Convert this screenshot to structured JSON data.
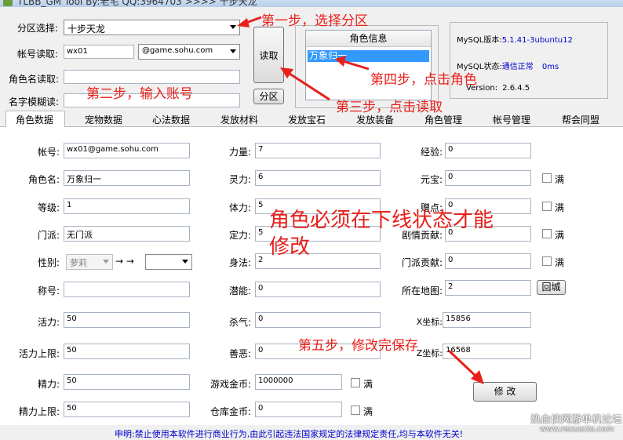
{
  "window": {
    "title": "TLBB_GM Tool By:老宅 QQ:3964703 >>>> 十步天龙"
  },
  "top": {
    "zone_label": "分区选择:",
    "zone_value": "十步天龙",
    "account_read_label": "帐号读取:",
    "account_value": "wx01",
    "domain_value": "@game.sohu.com",
    "role_read_label": "角色名读取:",
    "fuzzy_label": "名字模糊读:",
    "read_button": "读取",
    "zone_button": "分区",
    "role_group_title": "角色信息",
    "role_selected": "万象归一",
    "mysql_version_label": "MySQL版本:",
    "mysql_version_value": "5.1.41-3ubuntu12",
    "mysql_status_label": "MySQL状态:",
    "mysql_status_value": "通信正常",
    "mysql_latency": "0ms",
    "version_label": "Version:",
    "version_value": "2.6.4.5"
  },
  "tabs": [
    "角色数据",
    "宠物数据",
    "心法数据",
    "发放材料",
    "发放宝石",
    "发放装备",
    "角色管理",
    "帐号管理",
    "帮会同盟"
  ],
  "fields": {
    "account": {
      "label": "帐号:",
      "value": "wx01@game.sohu.com"
    },
    "role_name": {
      "label": "角色名:",
      "value": "万象归一"
    },
    "level": {
      "label": "等级:",
      "value": "1"
    },
    "sect": {
      "label": "门派:",
      "value": "无门派"
    },
    "gender": {
      "label": "性别:",
      "value": "萝莉",
      "arrows": "→ →"
    },
    "title": {
      "label": "称号:",
      "value": ""
    },
    "vigor": {
      "label": "活力:",
      "value": "50"
    },
    "vigor_max": {
      "label": "活力上限:",
      "value": "50"
    },
    "energy": {
      "label": "精力:",
      "value": "50"
    },
    "energy_max": {
      "label": "精力上限:",
      "value": "50"
    },
    "strength": {
      "label": "力量:",
      "value": "7"
    },
    "spirit": {
      "label": "灵力:",
      "value": "6"
    },
    "stamina": {
      "label": "体力:",
      "value": "5"
    },
    "focus": {
      "label": "定力:",
      "value": "5"
    },
    "agility": {
      "label": "身法:",
      "value": "2"
    },
    "potential": {
      "label": "潜能:",
      "value": "0"
    },
    "murder": {
      "label": "杀气:",
      "value": "0"
    },
    "goodness": {
      "label": "善恶:",
      "value": "0"
    },
    "gold": {
      "label": "游戏金币:",
      "value": "1000000",
      "full": "满"
    },
    "bank_gold": {
      "label": "仓库金币:",
      "value": "0",
      "full": "满"
    },
    "exp": {
      "label": "经验:",
      "value": "0"
    },
    "yuanbao": {
      "label": "元宝:",
      "value": "0",
      "full": "满"
    },
    "gift_points": {
      "label": "赠点:",
      "value": "0",
      "full": "满"
    },
    "plot_contrib": {
      "label": "剧情贡献:",
      "value": "0",
      "full": "满"
    },
    "sect_contrib": {
      "label": "门派贡献:",
      "value": "0",
      "full": "满"
    },
    "map": {
      "label": "所在地图:",
      "value": "2",
      "return_button": "回城"
    },
    "x_coord": {
      "label": "X坐标:",
      "value": "15856"
    },
    "z_coord": {
      "label": "Z坐标:",
      "value": "16568"
    },
    "modify_button": "修 改"
  },
  "annotations": {
    "step1": "第一步，选择分区",
    "step2": "第二步，输入账号",
    "step3": "第三步，点击读取",
    "step4": "第四步，点击角色",
    "step5": "第五步，修改完保存",
    "notice": "角色必须在下线状态才能修改"
  },
  "footer": {
    "disclaimer": "申明:禁止使用本软件进行商业行为,由此引起违法国家规定的法律规定责任,均与本软件无关!"
  },
  "watermark": {
    "text": "热血侠网游单机论坛",
    "url": "www.rexuexia.com"
  },
  "colors": {
    "annotation": "#e8201b",
    "selection": "#3399ff",
    "status_ok": "#0000cc"
  }
}
